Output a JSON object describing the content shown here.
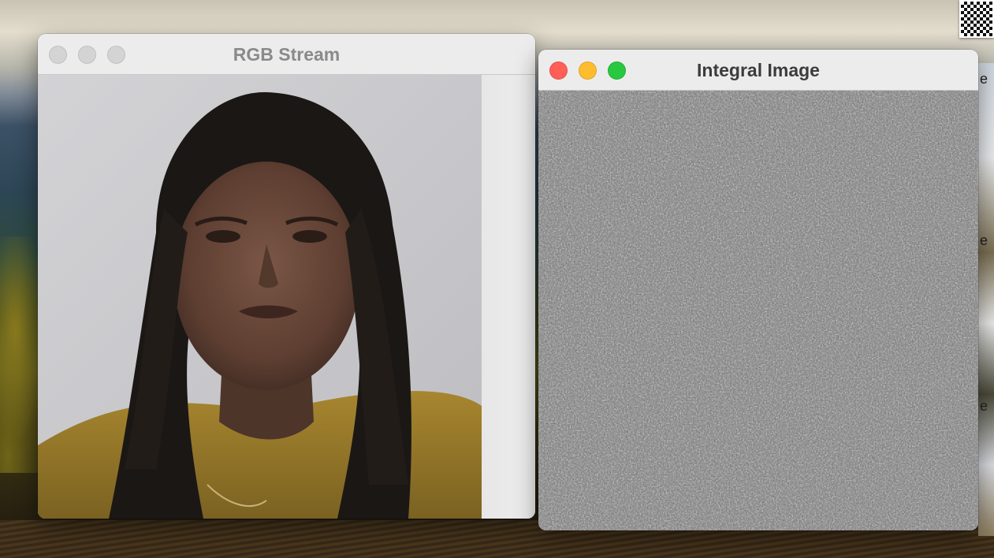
{
  "desktop": {
    "edge_letters": [
      "e",
      "e",
      "e"
    ]
  },
  "windows": {
    "rgb_stream": {
      "title": "RGB Stream",
      "state": "inactive"
    },
    "integral_image": {
      "title": "Integral Image",
      "state": "active"
    }
  },
  "icons": {
    "window_controls": [
      "close-icon",
      "minimize-icon",
      "zoom-icon"
    ],
    "desktop_icon": "checkerboard-icon"
  },
  "colors": {
    "close": "#ff5f57",
    "minimize": "#febc2e",
    "zoom": "#28c840",
    "titlebar": "#ececec"
  }
}
